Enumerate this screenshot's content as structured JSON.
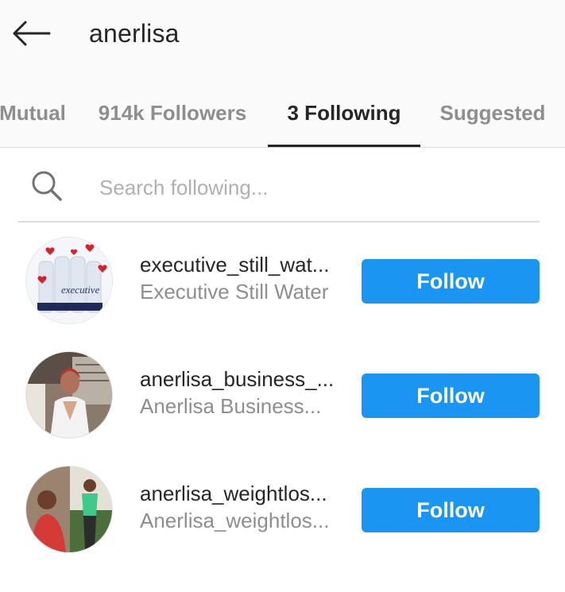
{
  "header": {
    "title": "anerlisa",
    "back_icon": "arrow-left-icon"
  },
  "tabs": [
    {
      "label": "Mutual",
      "active": false
    },
    {
      "label": "914k Followers",
      "active": false
    },
    {
      "label": "3 Following",
      "active": true
    },
    {
      "label": "Suggested",
      "active": false
    }
  ],
  "search": {
    "placeholder": "Search following...",
    "value": "",
    "icon": "search-icon"
  },
  "following": [
    {
      "username": "executive_still_wat...",
      "full_name": "Executive Still Water",
      "button": "Follow",
      "avatar": "avatar-executive"
    },
    {
      "username": "anerlisa_business_...",
      "full_name": "Anerlisa Business...",
      "button": "Follow",
      "avatar": "avatar-business"
    },
    {
      "username": "anerlisa_weightlos...",
      "full_name": "Anerlisa_weightlos...",
      "button": "Follow",
      "avatar": "avatar-weightloss"
    }
  ],
  "colors": {
    "follow_button": "#1a95f2",
    "tab_active": "#262626",
    "tab_inactive": "#8e8e8e"
  }
}
